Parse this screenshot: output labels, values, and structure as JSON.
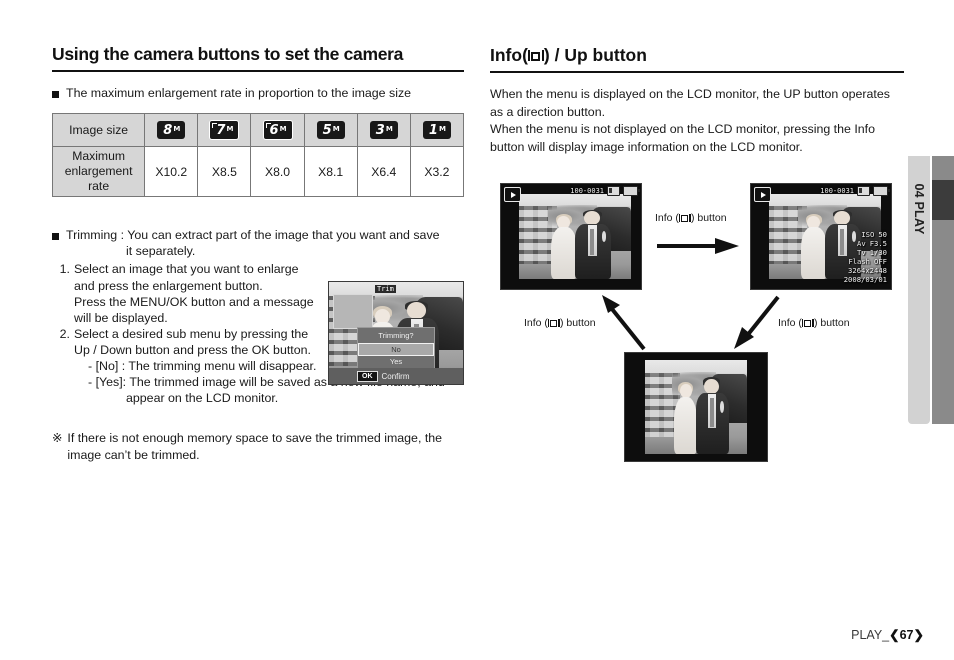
{
  "left": {
    "heading": "Using the camera buttons to set the camera",
    "bullet1": "The maximum enlargement rate in proportion to the image size",
    "table": {
      "row_headers": [
        "Image size",
        "Maximum enlargement rate"
      ],
      "sizes": [
        {
          "num": "8",
          "unit": "M",
          "framed": false
        },
        {
          "num": "7",
          "unit": "M",
          "framed": true
        },
        {
          "num": "6",
          "unit": "M",
          "framed": true
        },
        {
          "num": "5",
          "unit": "M",
          "framed": false
        },
        {
          "num": "3",
          "unit": "M",
          "framed": false
        },
        {
          "num": "1",
          "unit": "M",
          "framed": false
        }
      ],
      "rates": [
        "X10.2",
        "X8.5",
        "X8.0",
        "X8.1",
        "X6.4",
        "X3.2"
      ]
    },
    "bullet2_line1": "Trimming : You can extract part of the image that you want and save",
    "bullet2_line2": "it separately.",
    "steps": [
      {
        "num": "1.",
        "lines": [
          "Select an image that you want to enlarge",
          "and press the enlargement button.",
          "Press the MENU/OK button and a message",
          "will be displayed."
        ]
      },
      {
        "num": "2.",
        "lines": [
          "Select a desired sub menu by pressing the",
          "Up / Down button and press the OK button."
        ]
      }
    ],
    "sub_items": [
      "- [No]  : The trimming menu will disappear.",
      "- [Yes]: The trimmed image will be saved as a new file name, and",
      "appear on the LCD monitor."
    ],
    "note_mark": "※",
    "note_line1": "If there is not enough memory space to save the trimmed image, the",
    "note_line2": "image can’t be trimmed.",
    "trim_lcd": {
      "tag": "Trim",
      "question": "Trimming?",
      "option_no": "No",
      "option_yes": "Yes",
      "ok_chip": "OK",
      "confirm": "Confirm"
    }
  },
  "right": {
    "heading_prefix": "Info(",
    "heading_suffix": ") / Up button",
    "para_lines": [
      "When the menu is displayed on the LCD monitor, the UP button operates",
      "as a direction button.",
      "When the menu is not displayed on the LCD monitor, pressing the Info",
      "button will display image information on the LCD monitor."
    ],
    "lcd_top_left": {
      "file_number": "100-0031"
    },
    "lcd_top_right": {
      "file_number": "100-0031",
      "exif": [
        {
          "label": "ISO",
          "value": "50"
        },
        {
          "label": "Av",
          "value": "F3.5"
        },
        {
          "label": "Tv",
          "value": "1/30"
        },
        {
          "label": "Flash",
          "value": "OFF"
        }
      ],
      "resolution": "3264x2448",
      "date": "2008/03/01"
    },
    "flow_labels": {
      "top": {
        "prefix": "Info (",
        "suffix": ") button"
      },
      "left": {
        "prefix": "Info (",
        "suffix": ") button"
      },
      "right": {
        "prefix": "Info (",
        "suffix": ") button"
      }
    }
  },
  "sidebar": {
    "tab_label": "04 PLAY"
  },
  "footer": {
    "section": "PLAY_",
    "open_bracket": "❮",
    "page": "67",
    "close_bracket": "❯"
  }
}
